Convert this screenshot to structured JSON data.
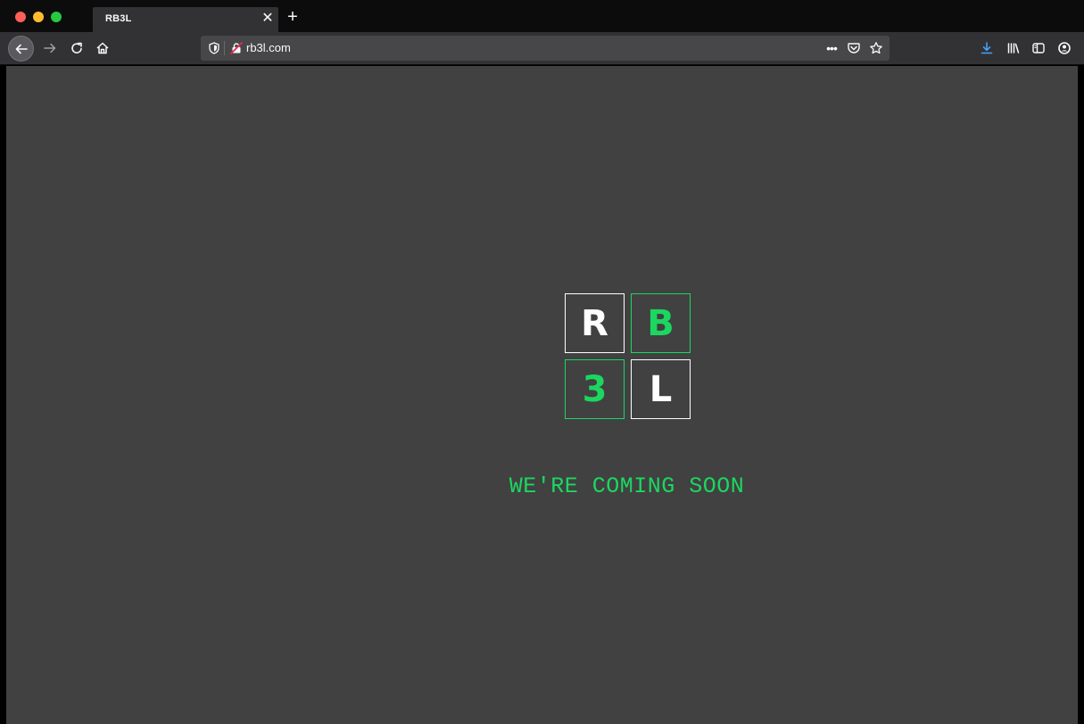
{
  "browser": {
    "tab": {
      "title": "RB3L"
    },
    "url": "rb3l.com"
  },
  "colors": {
    "accent_green": "#1bd760",
    "page_background": "#414141"
  },
  "page": {
    "logo": {
      "tile_1": "R",
      "tile_2": "B",
      "tile_3": "3",
      "tile_4": "L"
    },
    "headline": "WE'RE COMING SOON"
  },
  "icons": {
    "nav": [
      "back-arrow-icon",
      "forward-arrow-icon",
      "reload-icon",
      "home-icon"
    ],
    "urlbar": [
      "tracking-shield-icon",
      "insecure-lock-icon",
      "more-actions-icon",
      "pocket-icon",
      "bookmark-star-icon"
    ],
    "toolbar": [
      "download-icon",
      "library-icon",
      "sidebar-icon",
      "account-icon"
    ]
  }
}
